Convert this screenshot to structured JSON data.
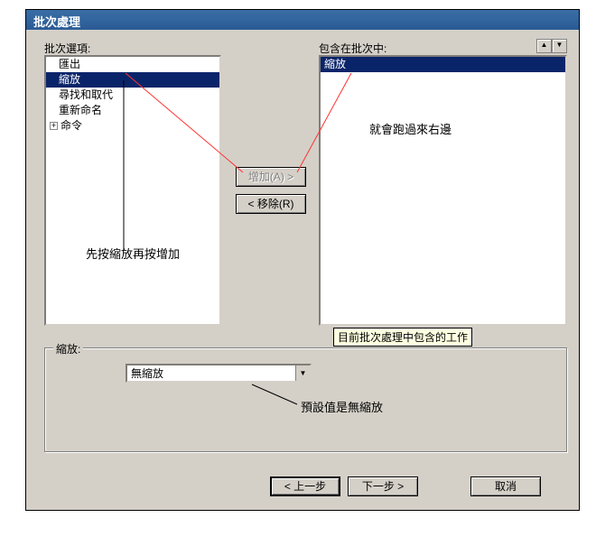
{
  "title": "批次處理",
  "labels": {
    "options": "批次選項:",
    "included": "包含在批次中:"
  },
  "left_list": {
    "items": [
      "匯出",
      "縮放",
      "尋找和取代",
      "重新命名"
    ],
    "selected_index": 1,
    "tree_root": "命令"
  },
  "right_list": {
    "items": [
      "縮放"
    ]
  },
  "buttons": {
    "add": "增加(A) >",
    "remove": "< 移除(R)",
    "back": "< 上一步",
    "next": "下一步 >",
    "cancel": "取消"
  },
  "group": {
    "label": "縮放:",
    "combo_value": "無縮放"
  },
  "tooltip": "目前批次處理中包含的工作",
  "annotations": {
    "a1": "先按縮放再按增加",
    "a2": "就會跑過來右邊",
    "a3": "預設值是無縮放"
  }
}
